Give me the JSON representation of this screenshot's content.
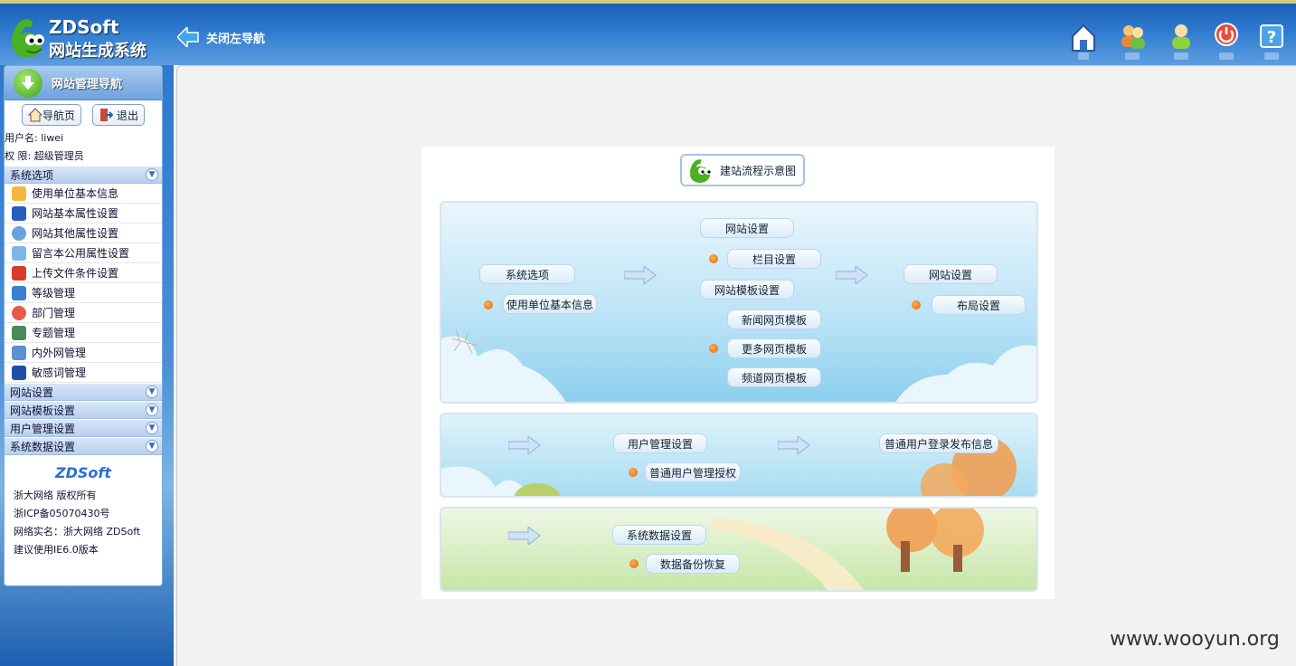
{
  "header": {
    "brand_line1": "ZDSoft",
    "brand_line2": "网站生成系统",
    "close_nav_label": "关闭左导航",
    "icons": [
      "home-icon",
      "users-icon",
      "user-icon",
      "power-icon",
      "help-icon"
    ]
  },
  "sidebar": {
    "title": "网站管理导航",
    "nav_button_label": "导航页",
    "logout_button_label": "退出",
    "username_line": "用户名: liwei",
    "role_line": "权 限:  超级管理员",
    "sections": [
      {
        "label": "系统选项",
        "items": [
          "使用单位基本信息",
          "网站基本属性设置",
          "网站其他属性设置",
          "留言本公用属性设置",
          "上传文件条件设置",
          "等级管理",
          "部门管理",
          "专题管理",
          "内外网管理",
          "敏感词管理"
        ]
      },
      {
        "label": "网站设置"
      },
      {
        "label": "网站模板设置"
      },
      {
        "label": "用户管理设置"
      },
      {
        "label": "系统数据设置"
      }
    ],
    "footer": {
      "logo_text": "ZDSoft",
      "lines": [
        "浙大网络 版权所有",
        "浙ICP备05070430号",
        "网络实名：浙大网络 ZDSoft",
        "建议使用IE6.0版本"
      ]
    }
  },
  "flowchart": {
    "title": "建站流程示意图",
    "panel1": {
      "system_options": "系统选项",
      "unit_info": "使用单位基本信息",
      "site_settings": "网站设置",
      "column_settings": "栏目设置",
      "template_settings": "网站模板设置",
      "news_template": "新闻网页模板",
      "more_template": "更多网页模板",
      "channel_template": "频道网页模板",
      "site_settings2": "网站设置",
      "layout_settings": "布局设置"
    },
    "panel2": {
      "user_mgmt": "用户管理设置",
      "user_auth": "普通用户管理授权",
      "user_publish": "普通用户登录发布信息"
    },
    "panel3": {
      "data_settings": "系统数据设置",
      "backup": "数据备份恢复"
    }
  },
  "watermark": "www.wooyun.org",
  "colors": {
    "header_blue": "#2f7bd0",
    "accent_orange": "#e0601a",
    "panel_border": "#d9e4ef"
  }
}
